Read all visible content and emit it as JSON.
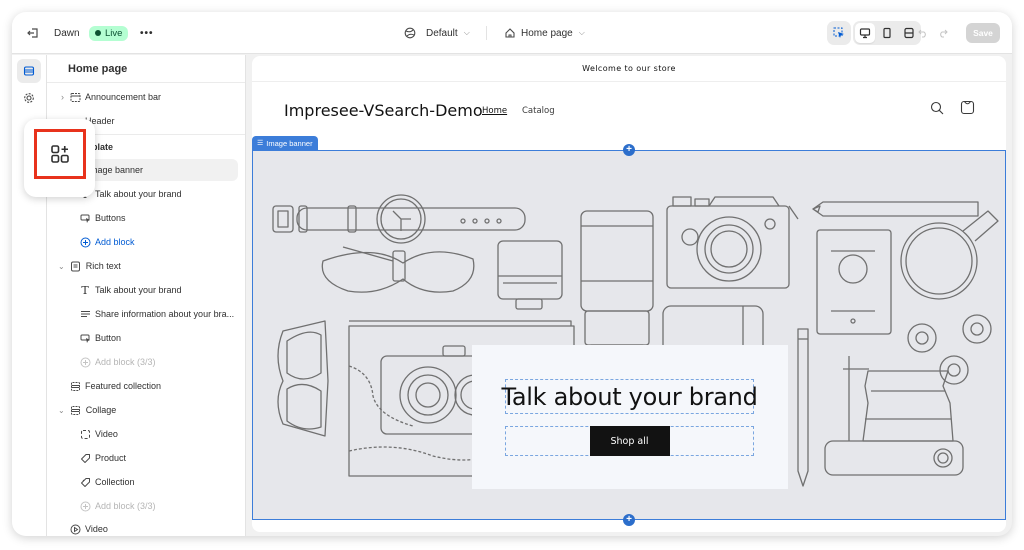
{
  "topbar": {
    "theme_name": "Dawn",
    "live_label": "Live",
    "more_label": "•••",
    "view_select": "Default",
    "page_select": "Home page",
    "save_label": "Save"
  },
  "sidebar": {
    "title": "Home page",
    "items": [
      {
        "label": "Announcement bar",
        "icon": "section-icon",
        "chevron": "›"
      },
      {
        "label": "Header",
        "icon": "section-icon"
      },
      {
        "label": "Template",
        "visible_label": "plate",
        "group": true
      },
      {
        "label": "Image banner",
        "visible_label": "mage banner",
        "icon": "image-icon",
        "selected": true
      },
      {
        "label": "Talk about your brand",
        "icon": "text-icon"
      },
      {
        "label": "Buttons",
        "icon": "button-icon"
      },
      {
        "label": "Add block",
        "icon": "plus-circle-icon",
        "style": "link"
      },
      {
        "label": "Rich text",
        "icon": "rich-text-icon",
        "chevron": "⌄"
      },
      {
        "label": "Talk about your brand",
        "icon": "text-icon"
      },
      {
        "label": "Share information about your bra...",
        "icon": "paragraph-icon"
      },
      {
        "label": "Button",
        "icon": "button-icon"
      },
      {
        "label": "Add block (3/3)",
        "icon": "plus-circle-icon",
        "style": "disabled"
      },
      {
        "label": "Featured collection",
        "icon": "section-icon"
      },
      {
        "label": "Collage",
        "icon": "section-icon",
        "chevron": "⌄"
      },
      {
        "label": "Video",
        "icon": "video-frame-icon"
      },
      {
        "label": "Product",
        "icon": "tag-icon"
      },
      {
        "label": "Collection",
        "icon": "collection-icon"
      },
      {
        "label": "Add block (3/3)",
        "icon": "plus-circle-icon",
        "style": "disabled"
      },
      {
        "label": "Video",
        "icon": "play-circle-icon"
      }
    ]
  },
  "preview": {
    "announcement": "Welcome to our store",
    "store_name": "Impresee-VSearch-Demo",
    "nav": [
      "Home",
      "Catalog"
    ],
    "section_tag": "Image banner",
    "banner_heading": "Talk about your brand",
    "banner_button": "Shop all",
    "add_section_symbol": "+"
  },
  "colors": {
    "accent_blue": "#2c6ecb",
    "live_badge_bg": "#b4fed2",
    "highlight_red": "#e8321c",
    "banner_bg": "#e6e7eb"
  }
}
